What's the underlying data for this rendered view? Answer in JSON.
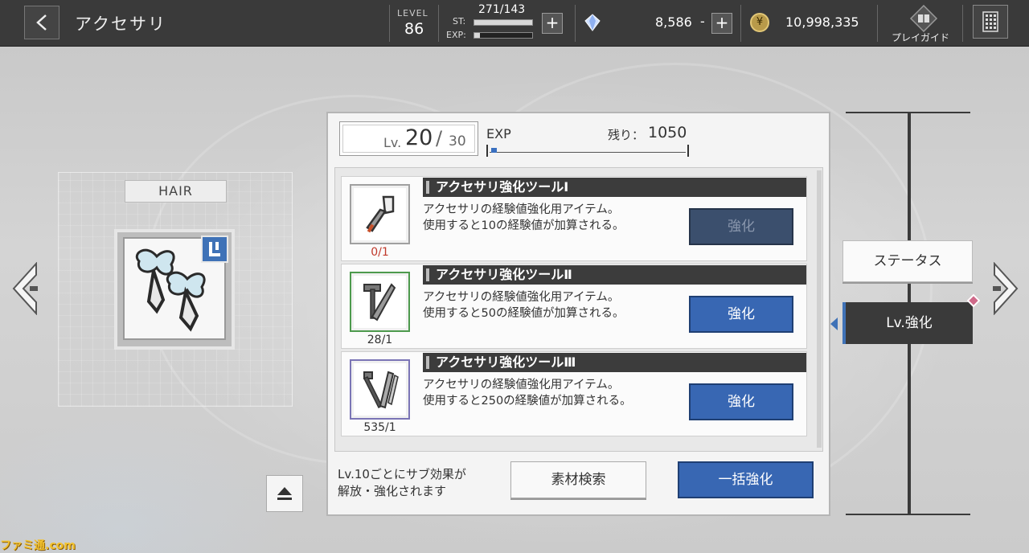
{
  "header": {
    "title": "アクセサリ",
    "level_label": "LEVEL",
    "level_value": "86",
    "st_label": "ST:",
    "st_value": "271/143",
    "exp_label": "EXP:",
    "gems": "8,586",
    "gem_dash": "-",
    "coins": "10,998,335",
    "guide_label": "プレイガイド",
    "plus_symbol": "+"
  },
  "item": {
    "slot": "HAIR"
  },
  "panel": {
    "lv_prefix": "Lv.",
    "lv_current": "20",
    "lv_slash": "/",
    "lv_max": "30",
    "exp_title": "EXP",
    "remaining_label": "残り：",
    "remaining_value": "1050",
    "exp_fill": 0.03
  },
  "tools": [
    {
      "name": "アクセサリ強化ツールⅠ",
      "desc1": "アクセサリの経験値強化用アイテム。",
      "desc2": "使用すると10の経験値が加算される。",
      "count": "0/1",
      "button": "強化",
      "enabled": false
    },
    {
      "name": "アクセサリ強化ツールⅡ",
      "desc1": "アクセサリの経験値強化用アイテム。",
      "desc2": "使用すると50の経験値が加算される。",
      "count": "28/1",
      "button": "強化",
      "enabled": true
    },
    {
      "name": "アクセサリ強化ツールⅢ",
      "desc1": "アクセサリの経験値強化用アイテム。",
      "desc2": "使用すると250の経験値が加算される。",
      "count": "535/1",
      "button": "強化",
      "enabled": true
    }
  ],
  "footer": {
    "note_line1": "Lv.10ごとにサブ効果が",
    "note_line2": "解放・強化されます",
    "search_button": "素材検索",
    "bulk_button": "一括強化"
  },
  "tabs": {
    "status": "ステータス",
    "lv_up": "Lv.強化"
  },
  "watermark": "ファミ通.com",
  "colors": {
    "accent_blue": "#3867b3",
    "header_bg": "#3a3a3a",
    "count_red": "#c0392b"
  }
}
